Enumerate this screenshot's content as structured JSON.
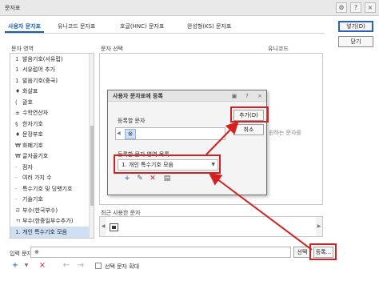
{
  "window": {
    "title": "문자표",
    "settings_icon": "gear-icon",
    "help_label": "?",
    "close_label": "×"
  },
  "tabs": [
    {
      "label": "사용자 문자표",
      "active": true
    },
    {
      "label": "유니코드 문자표",
      "active": false
    },
    {
      "label": "호글(HNC) 문자표",
      "active": false
    },
    {
      "label": "완성형(KS) 문자표",
      "active": false
    }
  ],
  "buttons": {
    "insert": "넣기(D)",
    "close": "닫기",
    "select": "선택",
    "register": "등록..."
  },
  "columns": {
    "area": "문자 영역",
    "select": "문자 선택",
    "unicode": "유니코드"
  },
  "areas": [
    {
      "glyph": "1",
      "label": "발음기호(서유럽)"
    },
    {
      "glyph": "1",
      "label": "서유럽어 추가"
    },
    {
      "glyph": "1",
      "label": "발음기호(중국)"
    },
    {
      "glyph": "♦",
      "label": "화살표"
    },
    {
      "glyph": "(",
      "label": "괄호"
    },
    {
      "glyph": "±",
      "label": "수학연산자"
    },
    {
      "glyph": "§",
      "label": "한자기호"
    },
    {
      "glyph": "♦",
      "label": "문장부호"
    },
    {
      "glyph": "₩",
      "label": "화폐기호"
    },
    {
      "glyph": "₩",
      "label": "글자꼴기호"
    },
    {
      "glyph": "·",
      "label": "점자"
    },
    {
      "glyph": "·",
      "label": "여러 가지 수"
    },
    {
      "glyph": "·",
      "label": "특수기호 및 딩뱃기호"
    },
    {
      "glyph": "·",
      "label": "기술기호"
    },
    {
      "glyph": "ㄹ",
      "label": "부수(한국부수)"
    },
    {
      "glyph": "ㄲ",
      "label": "부수(한중일부수추가)"
    },
    {
      "glyph": "1.",
      "label": "개인 특수기호 모음",
      "selected": true
    }
  ],
  "hint": "원하는 문자를",
  "recent": {
    "label": "최근 사용한 문자"
  },
  "input": {
    "label": "입력 문자",
    "value": "※"
  },
  "bottom_tools": {
    "add": "+",
    "remove": "×",
    "left": "←",
    "right": "→"
  },
  "checkbox": {
    "label": "선택 문자 확대",
    "checked": false
  },
  "dialog": {
    "title": "사용자 문자표에 등록",
    "help": "?",
    "close": "×",
    "chars_label": "등록할 문자",
    "selected_char": "※",
    "area_list_label": "등록할 문자 영역 목록",
    "area_value": "1. 개인 특수기호 모음",
    "add_button": "추가(D)",
    "cancel_button": "취소"
  },
  "annotation_color": "#d42020"
}
